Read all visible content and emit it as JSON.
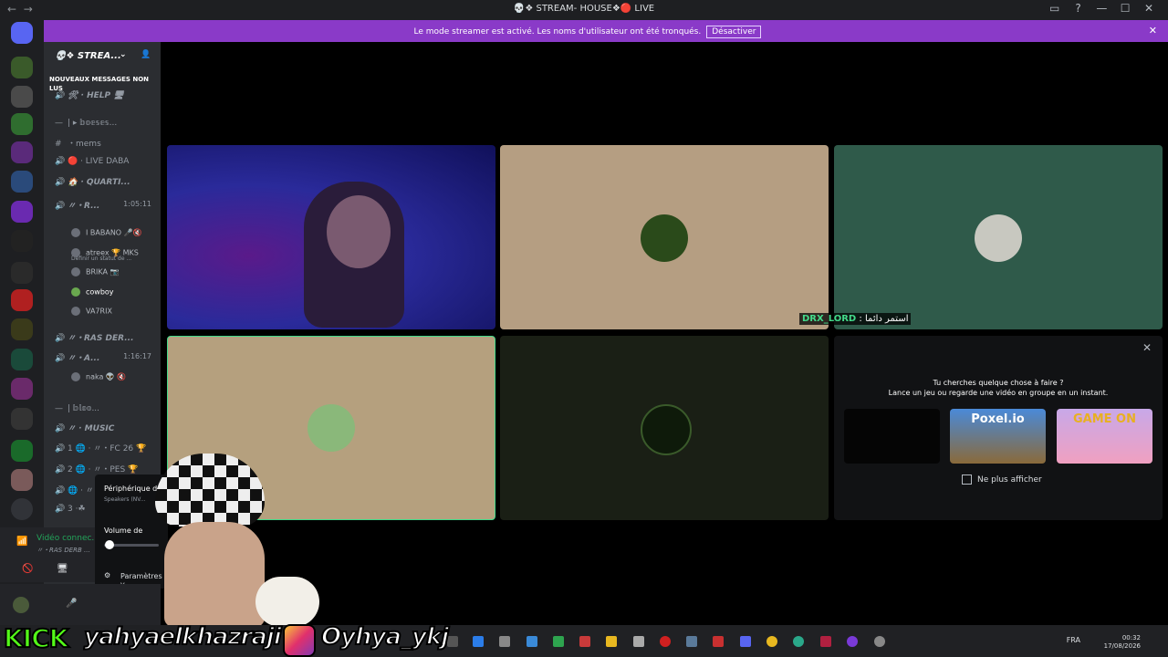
{
  "window": {
    "title": "💀❖ STREAM- HOUSE❖🔴 LIVE",
    "nav_back": "←",
    "nav_forward": "→",
    "controls": [
      "▭",
      "?",
      "—",
      "☐",
      "✕"
    ]
  },
  "banner": {
    "message": "Le mode streamer est activé. Les noms d'utilisateur ont été tronqués.",
    "button": "Désactiver",
    "close": "✕"
  },
  "server": {
    "name": "💀❖ STREA...",
    "new_messages": "NOUVEAUX MESSAGES NON LUS"
  },
  "channels": [
    {
      "icon": "🔊",
      "label": "🛠 · HELP 🖥"
    },
    {
      "icon": "—",
      "label": "| ▸ 𝕓𝕠𝕖𝕤𝕖𝕤...",
      "category": true
    },
    {
      "icon": "#",
      "label": "・mems"
    },
    {
      "icon": "🔊",
      "label": "🔴 · LIVE DABA"
    },
    {
      "icon": "🔊",
      "label": "🏠 · QUARTI..."
    },
    {
      "icon": "🔊",
      "label": "〃・R...",
      "time": "1:05:11"
    },
    {
      "icon": "🔊",
      "label": "〃・RAS DER...",
      "y": 0
    },
    {
      "icon": "🔊",
      "label": "〃・A...",
      "time": "1:16:17"
    },
    {
      "icon": "—",
      "label": "| 𝕓𝕝𝕠𝕠...",
      "category": true
    },
    {
      "icon": "🔊",
      "label": "〃 · MUSIC"
    },
    {
      "icon": "🔊",
      "label": "1 🌐 · 〃・FC 26 🏆"
    },
    {
      "icon": "🔊",
      "label": "2 🌐 · 〃・PES 🏆"
    },
    {
      "icon": "🔊",
      "label": "🌐 · 〃"
    },
    {
      "icon": "🔊",
      "label": "3 ·☘"
    }
  ],
  "status_hint": "Définir un statut de ...",
  "members": [
    {
      "name": "I BABANO",
      "extra": "🎤🔇"
    },
    {
      "name": "atreex",
      "extra": "🏆 MKS"
    },
    {
      "name": "BRIKA",
      "extra": "📷"
    },
    {
      "name": "cowboy",
      "extra": ""
    },
    {
      "name": "VA7RIX",
      "extra": ""
    },
    {
      "name": "naka",
      "extra": "👽 🔇"
    }
  ],
  "voice": {
    "status": "Vidéo connec...",
    "channel": "〃・RAS DERB ..."
  },
  "popup": {
    "device_title": "Périphérique d",
    "device_sub": "Speakers (NV...",
    "volume": "Volume de",
    "volume_level": 0.1,
    "settings": "Paramètres v"
  },
  "tiles": [
    {
      "name": "drx-cam",
      "label": "DRX_LORD",
      "label_suffix": ": استمر دائما"
    }
  ],
  "activity": {
    "question": "Tu cherches quelque chose à faire ?",
    "subtitle": "Lance un jeu ou regarde une vidéo en groupe en un instant.",
    "games": [
      "",
      "Poxel.io",
      "GAME ON"
    ],
    "dont_show": "Ne plus afficher"
  },
  "overlay": {
    "kick": "KICK",
    "kick_user": "yahyaelkhazraji",
    "instagram_user": "Oyhya_ykj"
  },
  "taskbar": {
    "lang": "FRA",
    "time": "00:32",
    "date": "17/08/2026"
  }
}
